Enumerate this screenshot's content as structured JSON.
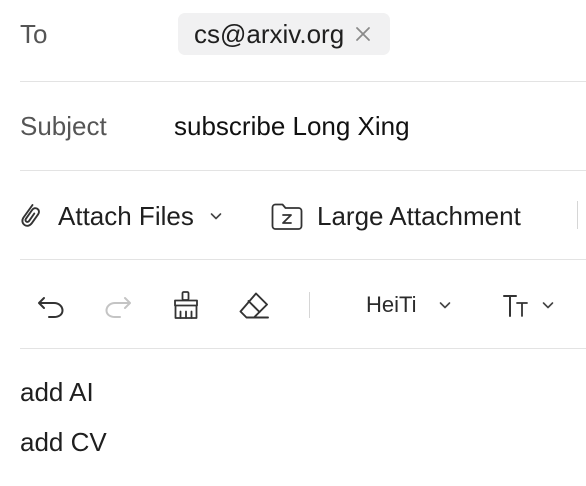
{
  "header": {
    "to_label": "To",
    "to_recipients": [
      {
        "address": "cs@arxiv.org"
      }
    ],
    "subject_label": "Subject",
    "subject_value": "subscribe Long Xing"
  },
  "attachments": {
    "attach_files_label": "Attach Files",
    "large_attachment_label": "Large Attachment"
  },
  "toolbar": {
    "icons": [
      "undo-icon",
      "redo-icon",
      "format-painter-icon",
      "eraser-icon"
    ],
    "font_family": "HeiTi",
    "font_size_icon": "font-size-icon"
  },
  "body": {
    "lines": [
      "add AI",
      "add CV"
    ]
  },
  "colors": {
    "chip_background": "#f1f1f2",
    "divider": "#e3e3e3",
    "disabled_icon": "#c4c4c4"
  }
}
